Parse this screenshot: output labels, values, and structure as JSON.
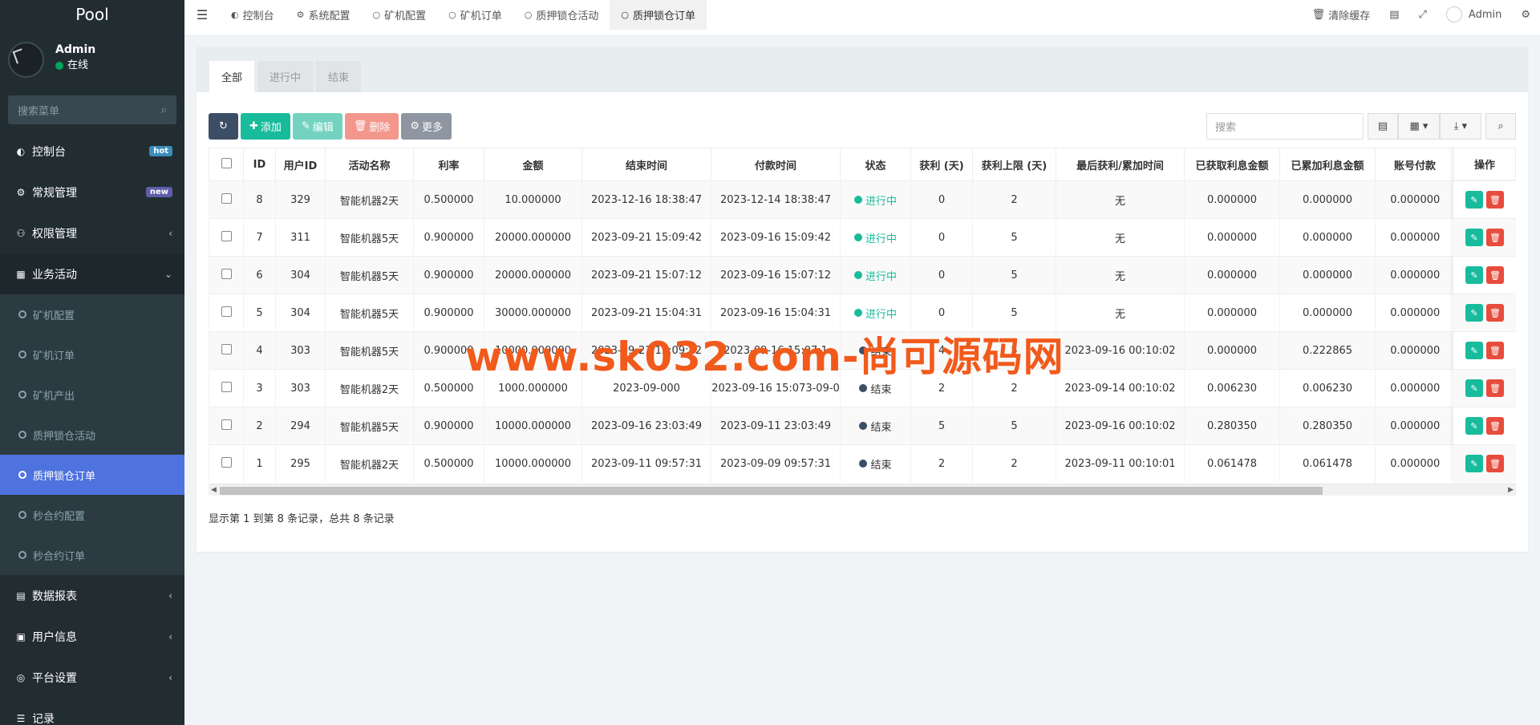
{
  "app": {
    "brand": "Pool"
  },
  "user": {
    "name": "Admin",
    "status": "在线"
  },
  "sidebar": {
    "search_placeholder": "搜索菜单",
    "items": [
      {
        "label": "控制台",
        "badge": "hot"
      },
      {
        "label": "常规管理",
        "badge": "new"
      },
      {
        "label": "权限管理"
      },
      {
        "label": "业务活动"
      }
    ],
    "sub_items": [
      "矿机配置",
      "矿机订单",
      "矿机产出",
      "质押锁仓活动",
      "质押锁仓订单",
      "秒合约配置",
      "秒合约订单"
    ],
    "items_after": [
      {
        "label": "数据报表"
      },
      {
        "label": "用户信息"
      },
      {
        "label": "平台设置"
      },
      {
        "label": "记录"
      }
    ]
  },
  "topbar": {
    "tabs": [
      "控制台",
      "系统配置",
      "矿机配置",
      "矿机订单",
      "质押锁仓活动",
      "质押锁仓订单"
    ],
    "clear_cache": "清除缓存",
    "admin": "Admin"
  },
  "filter_tabs": [
    "全部",
    "进行中",
    "结束"
  ],
  "toolbar": {
    "add": "添加",
    "edit": "编辑",
    "delete": "删除",
    "more": "更多",
    "search_placeholder": "搜索"
  },
  "table": {
    "columns": [
      "ID",
      "用户ID",
      "活动名称",
      "利率",
      "金额",
      "结束时间",
      "付款时间",
      "状态",
      "获利 (天)",
      "获利上限 (天)",
      "最后获利/累加时间",
      "已获取利息金额",
      "已累加利息金额",
      "账号付款",
      "操作"
    ],
    "rows": [
      [
        "8",
        "329",
        "智能机器2天",
        "0.500000",
        "10.000000",
        "2023-12-16 18:38:47",
        "2023-12-14 18:38:47",
        "进行中",
        "0",
        "2",
        "无",
        "0.000000",
        "0.000000",
        "0.000000"
      ],
      [
        "7",
        "311",
        "智能机器5天",
        "0.900000",
        "20000.000000",
        "2023-09-21 15:09:42",
        "2023-09-16 15:09:42",
        "进行中",
        "0",
        "5",
        "无",
        "0.000000",
        "0.000000",
        "0.000000"
      ],
      [
        "6",
        "304",
        "智能机器5天",
        "0.900000",
        "20000.000000",
        "2023-09-21 15:07:12",
        "2023-09-16 15:07:12",
        "进行中",
        "0",
        "5",
        "无",
        "0.000000",
        "0.000000",
        "0.000000"
      ],
      [
        "5",
        "304",
        "智能机器5天",
        "0.900000",
        "30000.000000",
        "2023-09-21 15:04:31",
        "2023-09-16 15:04:31",
        "进行中",
        "0",
        "5",
        "无",
        "0.000000",
        "0.000000",
        "0.000000"
      ],
      [
        "4",
        "303",
        "智能机器5天",
        "0.900000",
        "10000.000000",
        "2023-09-21 15:09:42",
        "2023-09-16 15:07:1",
        "结束",
        "4",
        "5",
        "2023-09-16 00:10:02",
        "0.000000",
        "0.222865",
        "0.000000"
      ],
      [
        "3",
        "303",
        "智能机器2天",
        "0.500000",
        "1000.000000",
        "2023-09-000",
        "2023-09-16 15:073-09-0",
        "结束",
        "2",
        "2",
        "2023-09-14 00:10:02",
        "0.006230",
        "0.006230",
        "0.000000"
      ],
      [
        "2",
        "294",
        "智能机器5天",
        "0.900000",
        "10000.000000",
        "2023-09-16 23:03:49",
        "2023-09-11 23:03:49",
        "结束",
        "5",
        "5",
        "2023-09-16 00:10:02",
        "0.280350",
        "0.280350",
        "0.000000"
      ],
      [
        "1",
        "295",
        "智能机器2天",
        "0.500000",
        "10000.000000",
        "2023-09-11 09:57:31",
        "2023-09-09 09:57:31",
        "结束",
        "2",
        "2",
        "2023-09-11 00:10:01",
        "0.061478",
        "0.061478",
        "0.000000"
      ]
    ]
  },
  "pagination_info": "显示第 1 到第 8 条记录，总共 8 条记录",
  "watermark": "www.sk032.com-尚可源码网",
  "colors": {
    "sidebar_bg": "#222d32",
    "active": "#4e73df",
    "success": "#18bc9c",
    "danger": "#e74c3c",
    "watermark": "#f15a1b"
  }
}
